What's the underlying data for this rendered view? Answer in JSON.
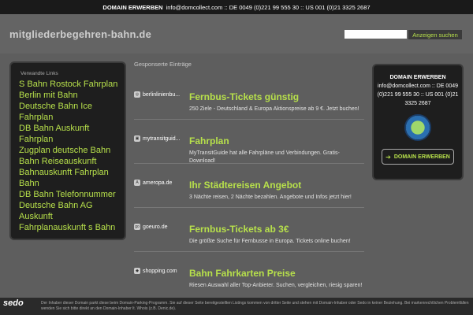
{
  "topbar": {
    "label": "DOMAIN ERWERBEN",
    "contact": "info@domcollect.com :: DE 0049 (0)221 99 555 30 :: US 001 (0)21 3325 2687"
  },
  "header": {
    "site_title": "mitgliederbegehren-bahn.de",
    "search_placeholder": "",
    "search_button": "Anzeigen suchen"
  },
  "left_panel": {
    "heading": "Verwandte Links",
    "links": [
      "S Bahn Rostock Fahrplan",
      "Berlin mit Bahn",
      "Deutsche Bahn Ice Fahrplan",
      "DB Bahn Auskunft Fahrplan",
      "Zugplan deutsche Bahn",
      "Bahn Reiseauskunft",
      "Bahnauskunft Fahrplan Bahn",
      "DB Bahn Telefonnummer",
      "Deutsche Bahn AG Auskunft",
      "Fahrplanauskunft s Bahn"
    ]
  },
  "center": {
    "heading": "Gesponserte Einträge",
    "ads": [
      {
        "domain": "berlinlinienbu...",
        "favicon": "globe-icon",
        "title": "Fernbus-Tickets günstig",
        "description": "250 Ziele - Deutschland & Europa Aktionspreise ab 9 €. Jetzt buchen!"
      },
      {
        "domain": "mytransitguid...",
        "favicon": "bus-icon",
        "title": "Fahrplan",
        "description": "MyTransitGuide hat alle Fahrpläne und Verbindungen. Gratis-Download!"
      },
      {
        "domain": "ameropa.de",
        "favicon": "a-icon",
        "title": "Ihr Städtereisen Angebot",
        "description": "3 Nächte reisen, 2 Nächte bezahlen. Angebote und Infos jetzt hier!"
      },
      {
        "domain": "goeuro.de",
        "favicon": "go-icon",
        "title": "Fernbus-Tickets ab 3€",
        "description": "Die größte Suche für Fernbusse in Europa. Tickets online buchen!"
      },
      {
        "domain": "shopping.com",
        "favicon": "shopping-icon",
        "title": "Bahn Fahrkarten Preise",
        "description": "Riesen Auswahl aller Top-Anbieter. Suchen, vergleichen, riesig sparen!"
      }
    ]
  },
  "right_panel": {
    "title": "DOMAIN ERWERBEN",
    "contact": "info@domcollect.com :: DE 0049 (0)221 99 555 30 :: US 001 (0)21 3325 2687",
    "button": "DOMAIN ERWERBEN"
  },
  "footer": {
    "logo": "sedo",
    "text": "Der Inhaber dieser Domain parkt diese beim Domain-Parking-Programm. Sie auf dieser Seite bereitgestellten Listings kommen von dritter Seite und stehen mit Domain-Inhaber oder Sedo in keiner Beziehung. Bei markenrechtlichen Problemfällen wenden Sie sich bitte direkt an den Domain-Inhaber lt. Whois (z.B. Denic.de)."
  },
  "colors": {
    "accent": "#b7e04b",
    "background": "#5e5e5e",
    "panel": "#1e1e1e"
  }
}
